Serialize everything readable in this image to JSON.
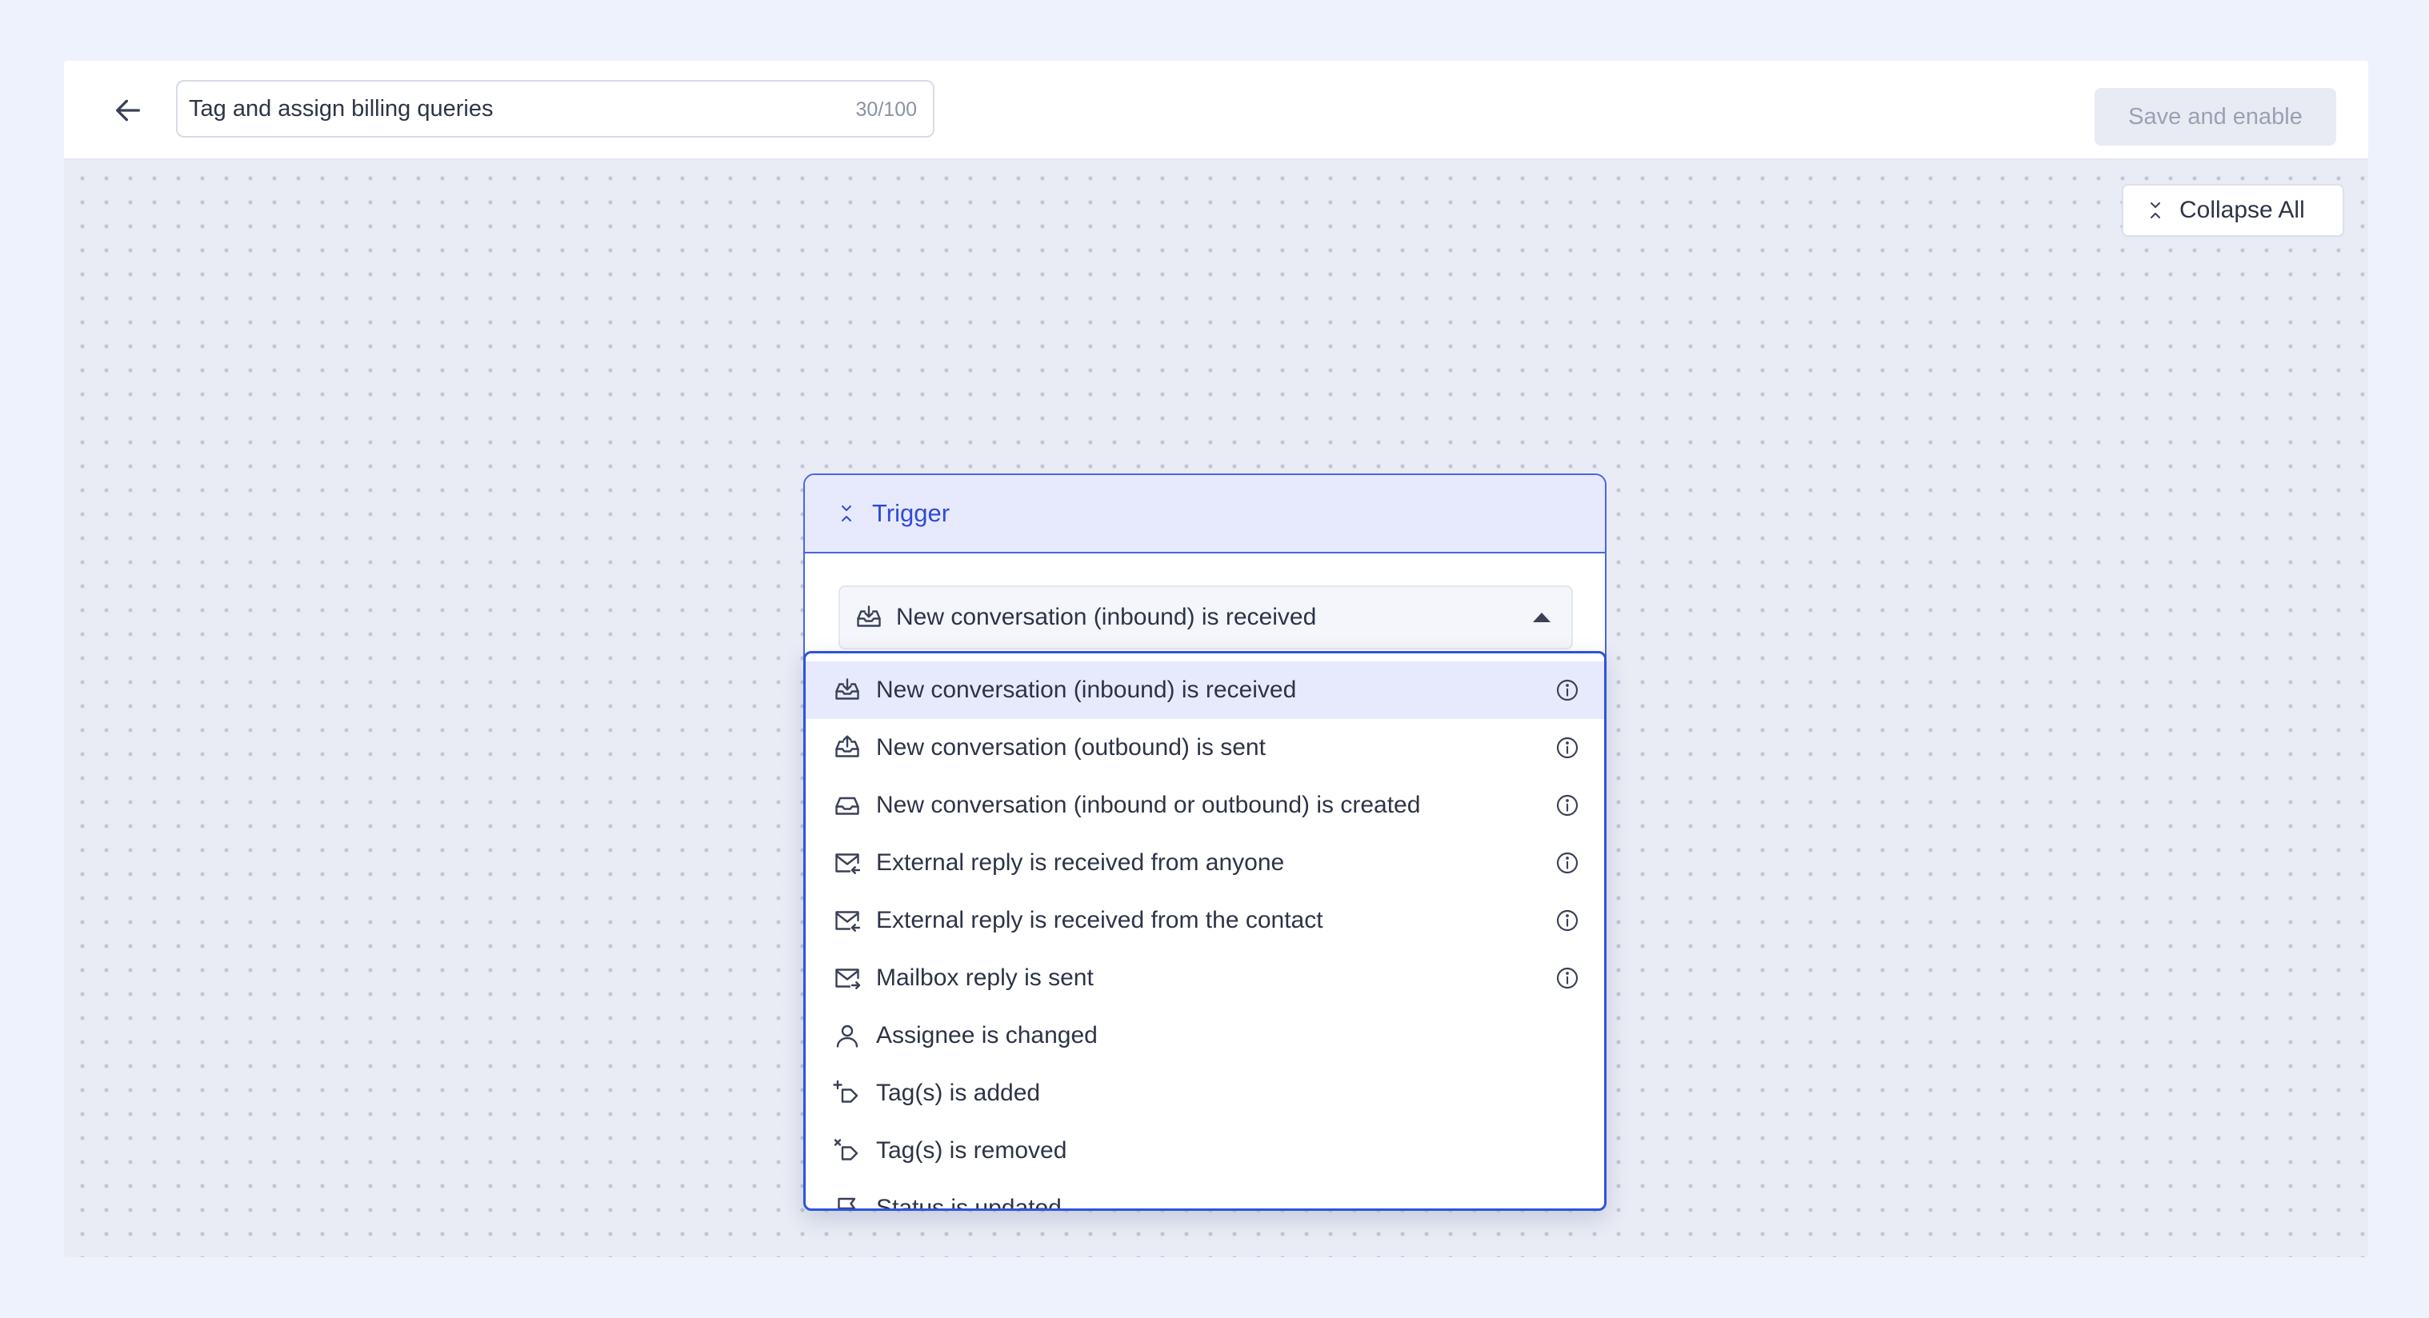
{
  "header": {
    "workflow_name": "Tag and assign billing queries",
    "char_counter": "30/100",
    "save_button_label": "Save and enable"
  },
  "canvas": {
    "collapse_all_label": "Collapse All"
  },
  "trigger": {
    "header_label": "Trigger",
    "selected_value": "New conversation (inbound) is received"
  },
  "dropdown": {
    "options": [
      {
        "label": "New conversation (inbound) is received",
        "icon": "inbox-in-icon",
        "has_info": true,
        "selected": true
      },
      {
        "label": "New conversation (outbound) is sent",
        "icon": "inbox-out-icon",
        "has_info": true
      },
      {
        "label": "New conversation (inbound or outbound) is created",
        "icon": "inbox-icon",
        "has_info": true
      },
      {
        "label": "External reply is received from anyone",
        "icon": "mail-reply-in-icon",
        "has_info": true
      },
      {
        "label": "External reply is received from the contact",
        "icon": "mail-reply-in-icon",
        "has_info": true
      },
      {
        "label": "Mailbox reply is sent",
        "icon": "mail-send-icon",
        "has_info": true
      },
      {
        "label": "Assignee is changed",
        "icon": "user-icon",
        "has_info": false
      },
      {
        "label": "Tag(s) is added",
        "icon": "tag-add-icon",
        "has_info": false
      },
      {
        "label": "Tag(s) is removed",
        "icon": "tag-remove-icon",
        "has_info": false
      },
      {
        "label": "Status is updated",
        "icon": "flag-icon",
        "has_info": false
      }
    ]
  },
  "colors": {
    "page_background": "#eef2fd",
    "accent": "#2f54d8",
    "trigger_header_bg": "#e7eafd",
    "disabled_button_bg": "#e8ebf3"
  }
}
